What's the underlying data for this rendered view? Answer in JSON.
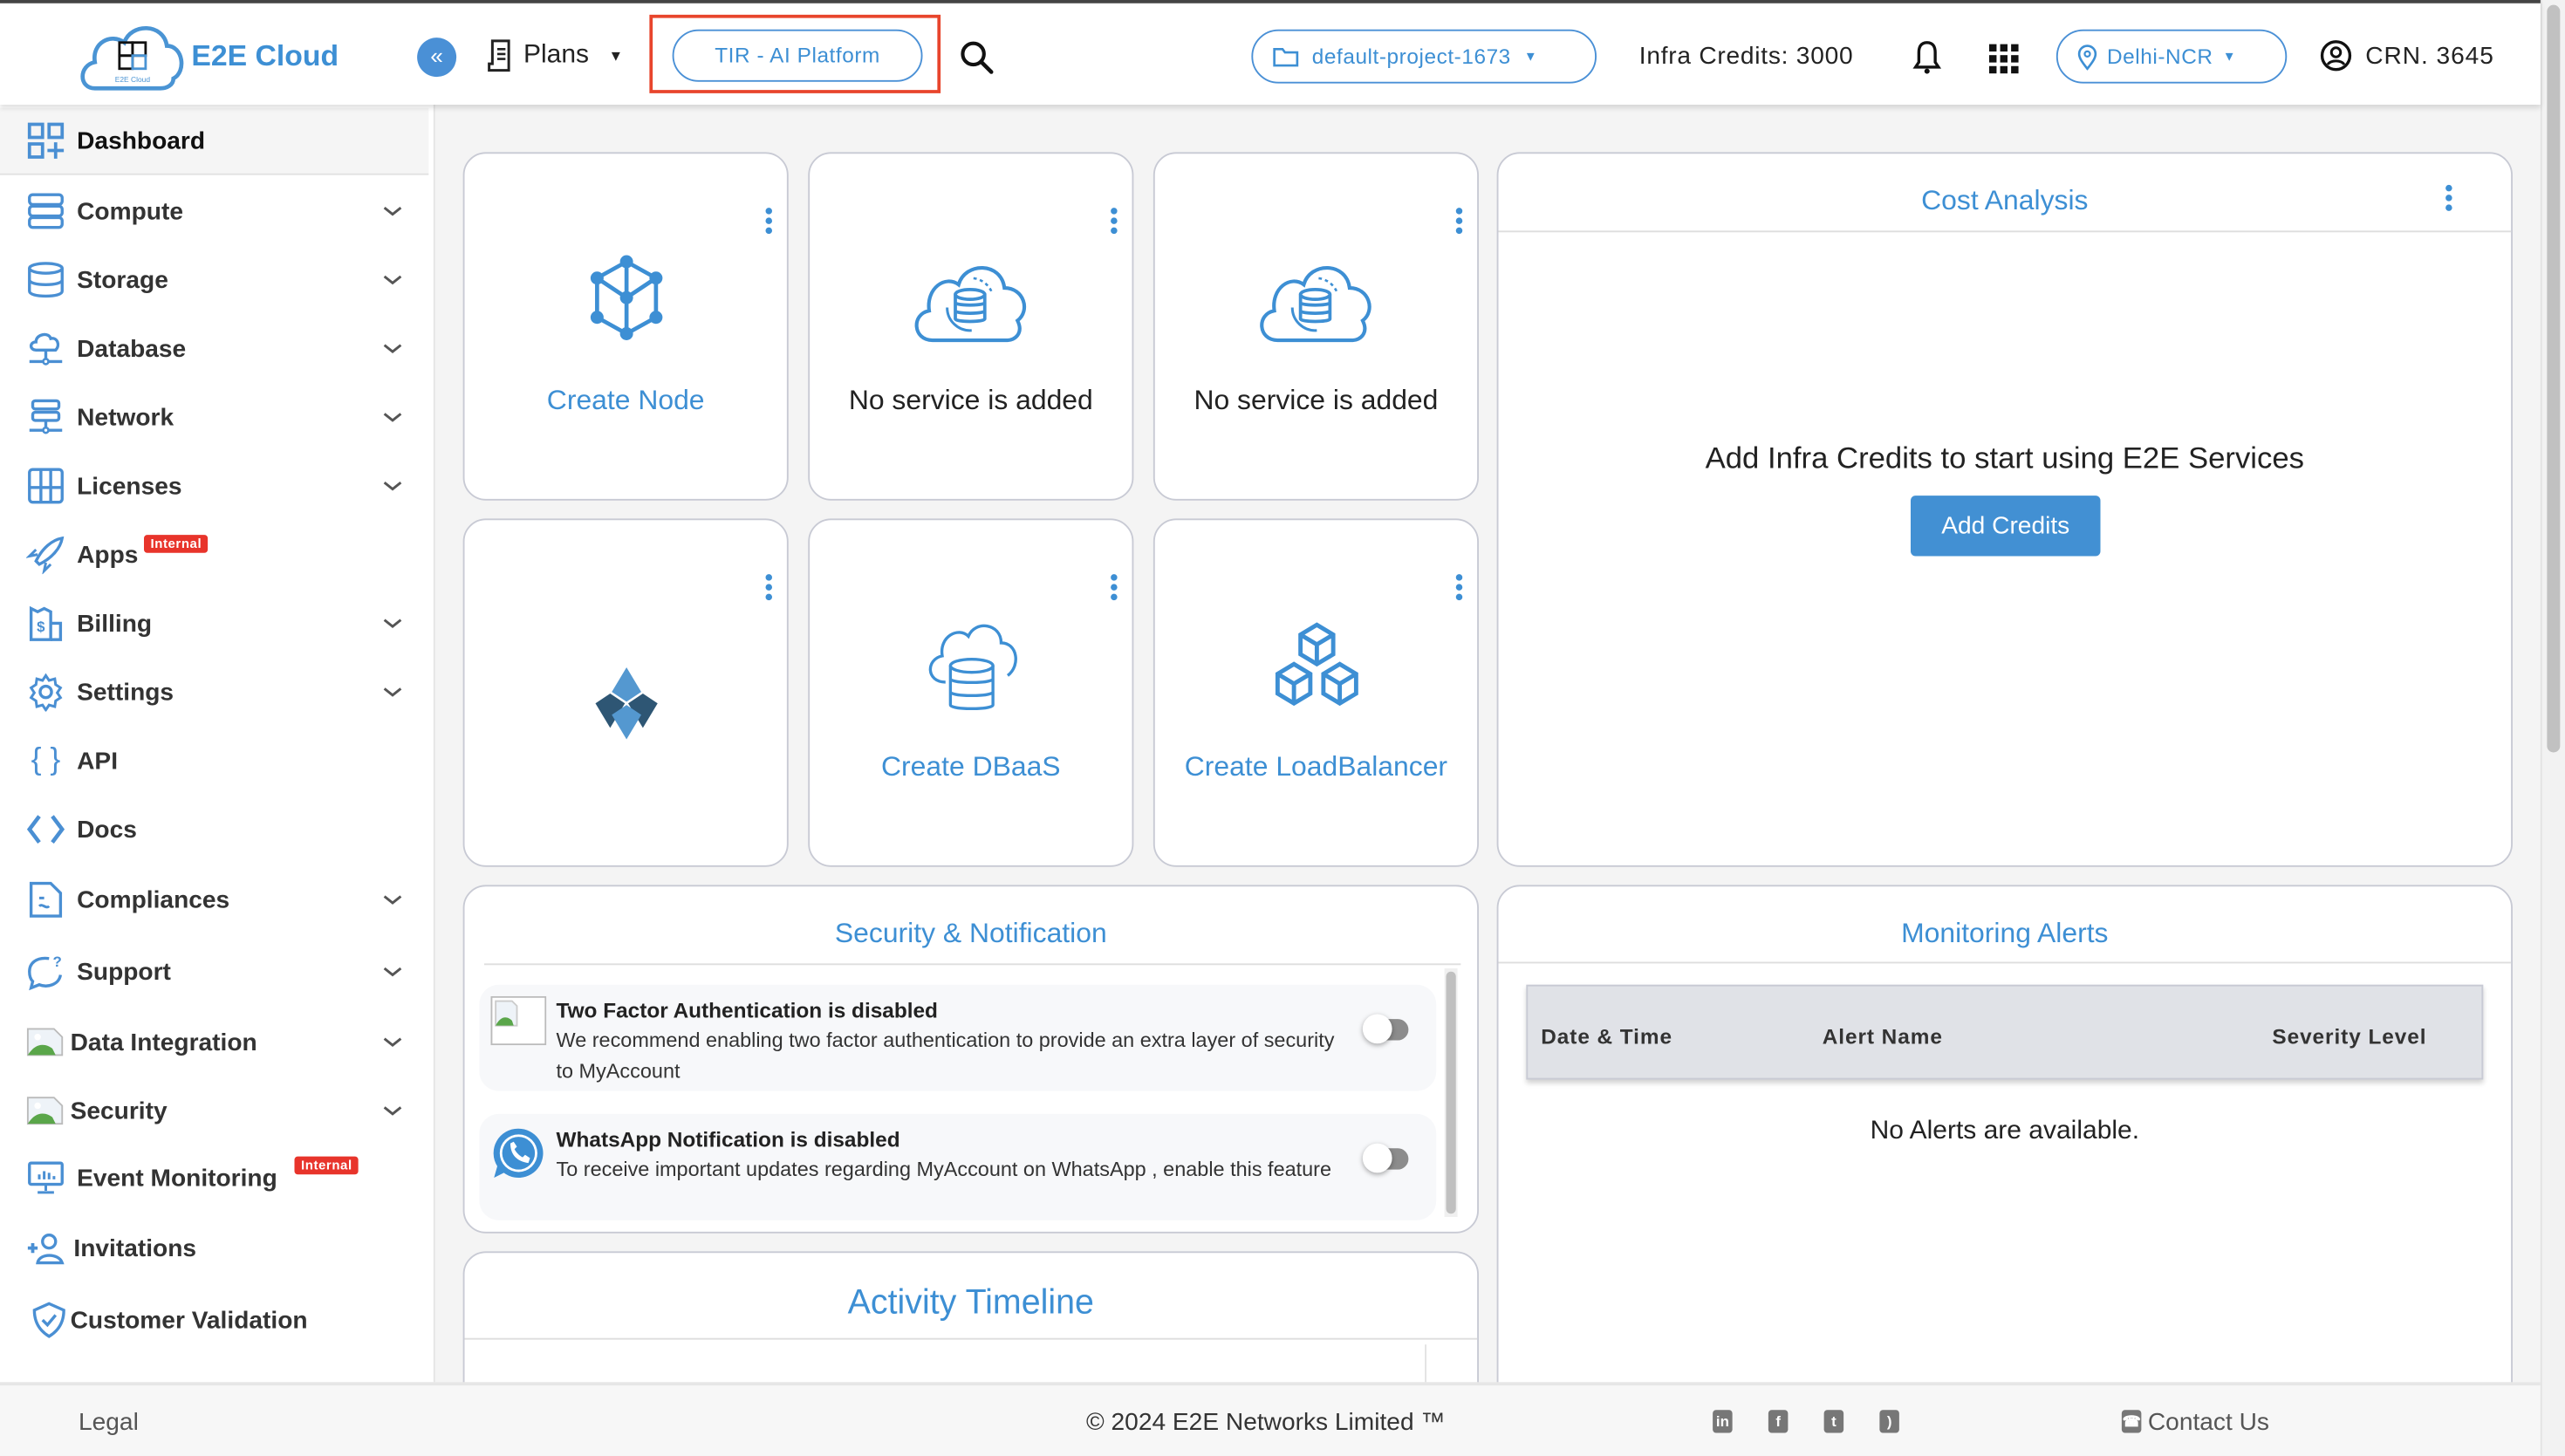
{
  "header": {
    "brand": "E2E Cloud",
    "logo_caption": "E2E Cloud",
    "collapse_icon": "«",
    "plans_label": "Plans",
    "tir_button": "TIR - AI Platform",
    "project_selector": "default-project-1673",
    "infra_credits": "Infra Credits: 3000",
    "region_selector": "Delhi-NCR",
    "crn": "CRN. 3645",
    "colors": {
      "accent": "#3d8fd4",
      "highlight_box": "#e8452c"
    }
  },
  "sidebar": {
    "items": [
      {
        "label": "Dashboard",
        "icon": "dashboard-icon",
        "active": true,
        "expandable": false
      },
      {
        "label": "Compute",
        "icon": "server-icon",
        "expandable": true
      },
      {
        "label": "Storage",
        "icon": "database-stack-icon",
        "expandable": true
      },
      {
        "label": "Database",
        "icon": "cloud-network-icon",
        "expandable": true
      },
      {
        "label": "Network",
        "icon": "network-server-icon",
        "expandable": true
      },
      {
        "label": "Licenses",
        "icon": "license-grid-icon",
        "expandable": true
      },
      {
        "label": "Apps",
        "icon": "rocket-icon",
        "expandable": false,
        "badge": "Internal"
      },
      {
        "label": "Billing",
        "icon": "billing-icon",
        "expandable": true
      },
      {
        "label": "Settings",
        "icon": "gear-icon",
        "expandable": true
      },
      {
        "label": "API",
        "icon": "braces-icon",
        "expandable": false
      },
      {
        "label": "Docs",
        "icon": "code-icon",
        "expandable": false
      },
      {
        "label": "Compliances",
        "icon": "document-icon",
        "expandable": true
      },
      {
        "label": "Support",
        "icon": "support-chat-icon",
        "expandable": true
      },
      {
        "label": "Data Integration",
        "icon": "broken-image-icon",
        "expandable": true
      },
      {
        "label": "Security",
        "icon": "broken-image-icon",
        "expandable": true
      },
      {
        "label": "Event Monitoring",
        "icon": "monitor-icon",
        "expandable": false,
        "badge": "Internal"
      },
      {
        "label": "Invitations",
        "icon": "add-user-icon",
        "expandable": false
      },
      {
        "label": "Customer Validation",
        "icon": "shield-check-icon",
        "expandable": false
      }
    ]
  },
  "tiles": [
    {
      "label": "Create Node",
      "icon": "node-cube-icon",
      "is_link": true
    },
    {
      "label": "No service is added",
      "icon": "cloud-database-sync-icon",
      "is_link": false
    },
    {
      "label": "No service is added",
      "icon": "cloud-database-sync-icon",
      "is_link": false
    },
    {
      "label": "",
      "icon": "diamond-logo-icon",
      "is_link": false
    },
    {
      "label": "Create DBaaS",
      "icon": "cloud-database-icon",
      "is_link": true
    },
    {
      "label": "Create LoadBalancer",
      "icon": "cubes-icon",
      "is_link": true
    }
  ],
  "cost_analysis": {
    "title": "Cost Analysis",
    "message": "Add Infra Credits to start using E2E Services",
    "button": "Add Credits"
  },
  "security_notification": {
    "title": "Security & Notification",
    "items": [
      {
        "title": "Two Factor Authentication is disabled",
        "description": "We recommend enabling two factor authentication to provide an extra layer of security to MyAccount",
        "enabled": false
      },
      {
        "title": "WhatsApp Notification is disabled",
        "description": "To receive important updates regarding MyAccount on WhatsApp , enable this feature",
        "enabled": false
      }
    ]
  },
  "monitoring_alerts": {
    "title": "Monitoring Alerts",
    "columns": [
      "Date & Time",
      "Alert Name",
      "Severity Level"
    ],
    "rows": [],
    "empty_message": "No Alerts are available."
  },
  "activity_timeline": {
    "title": "Activity Timeline"
  },
  "footer": {
    "legal": "Legal",
    "copyright": "© 2024 E2E Networks Limited ™",
    "social": [
      "linkedin",
      "facebook",
      "twitter",
      "rss"
    ],
    "contact": "Contact Us"
  }
}
